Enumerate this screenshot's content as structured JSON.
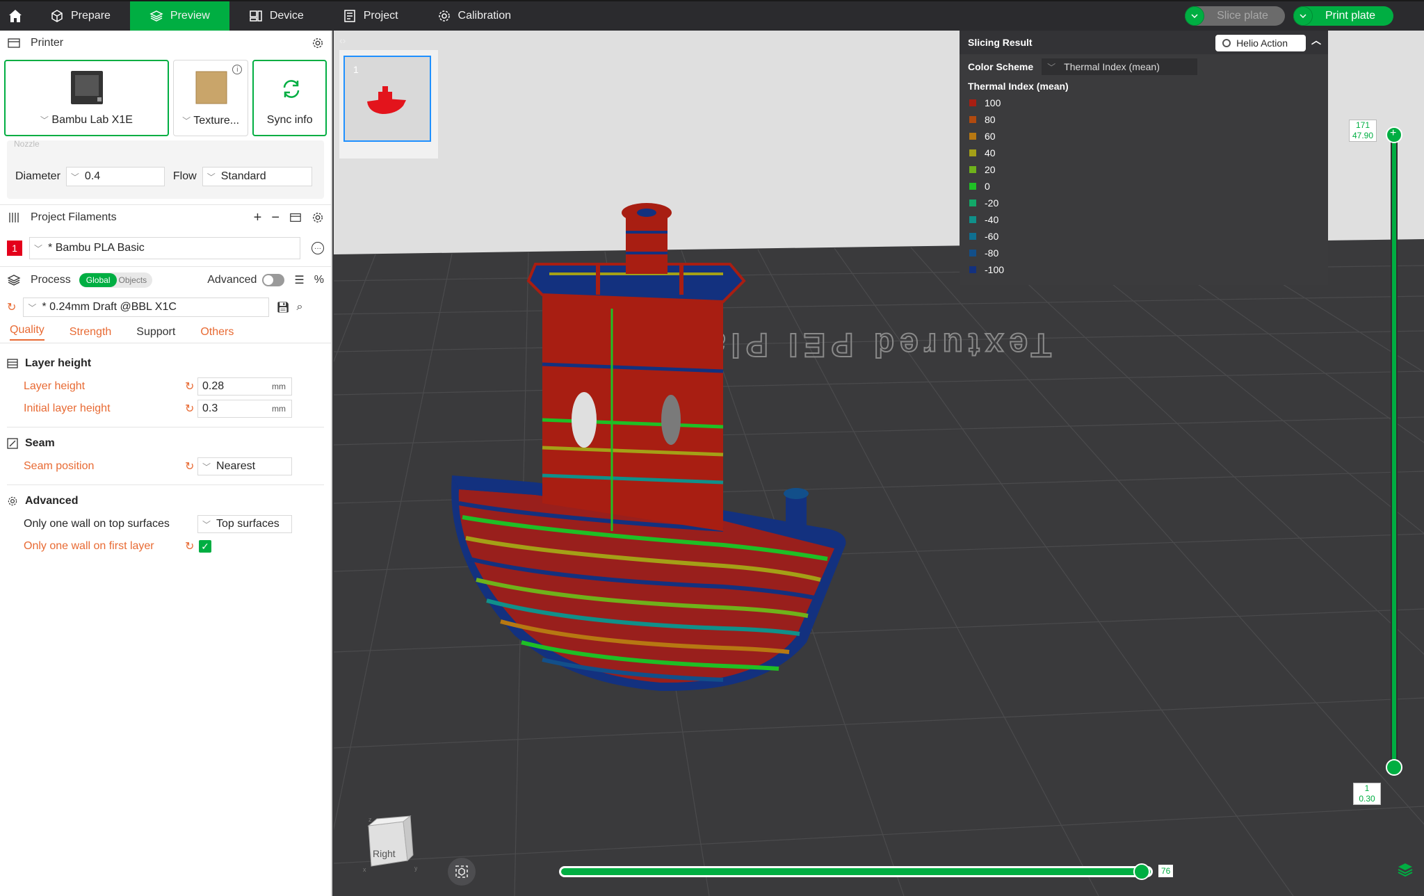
{
  "topbar": {
    "tabs": [
      {
        "label": "Prepare",
        "active": false
      },
      {
        "label": "Preview",
        "active": true
      },
      {
        "label": "Device",
        "active": false
      },
      {
        "label": "Project",
        "active": false
      },
      {
        "label": "Calibration",
        "active": false
      }
    ],
    "slice_label": "Slice plate",
    "print_label": "Print plate"
  },
  "printer": {
    "title": "Printer",
    "model": "Bambu Lab X1E",
    "plate": "Texture...",
    "sync": "Sync info",
    "nozzle_label": "Nozzle",
    "diameter_label": "Diameter",
    "diameter_value": "0.4",
    "flow_label": "Flow",
    "flow_value": "Standard"
  },
  "filaments": {
    "title": "Project Filaments",
    "items": [
      {
        "num": "1",
        "name": "* Bambu PLA Basic",
        "color": "#e4001b"
      }
    ]
  },
  "process": {
    "title": "Process",
    "global": "Global",
    "objects": "Objects",
    "advanced": "Advanced",
    "preset": "* 0.24mm Draft @BBL X1C",
    "tabs": [
      "Quality",
      "Strength",
      "Support",
      "Others"
    ],
    "groups": {
      "layer_height": {
        "title": "Layer height",
        "layer_height_label": "Layer height",
        "layer_height_value": "0.28",
        "initial_label": "Initial layer height",
        "initial_value": "0.3",
        "unit": "mm"
      },
      "seam": {
        "title": "Seam",
        "position_label": "Seam position",
        "position_value": "Nearest"
      },
      "advanced": {
        "title": "Advanced",
        "one_wall_top_label": "Only one wall on top surfaces",
        "one_wall_top_value": "Top surfaces",
        "one_wall_first_label": "Only one wall on first layer",
        "one_wall_first_checked": true
      }
    }
  },
  "viewport": {
    "plate_number": "1",
    "bed_text": "Textured PEI Plate",
    "cube_label": "Right",
    "layer_top": "171",
    "layer_top_height": "47.90",
    "layer_bottom": "1",
    "layer_bottom_height": "0.30",
    "move_value": "76",
    "move_progress": 1.0
  },
  "slicing_result": {
    "title": "Slicing Result",
    "helio": "Helio Action",
    "scheme_label": "Color Scheme",
    "scheme_value": "Thermal Index (mean)",
    "legend_title": "Thermal Index (mean)",
    "legend": [
      {
        "label": "100",
        "color": "#a81e12"
      },
      {
        "label": "80",
        "color": "#b14a0f"
      },
      {
        "label": "60",
        "color": "#b77812"
      },
      {
        "label": "40",
        "color": "#a4a017"
      },
      {
        "label": "20",
        "color": "#6fb21b"
      },
      {
        "label": "0",
        "color": "#1fbf25"
      },
      {
        "label": "-20",
        "color": "#12a868"
      },
      {
        "label": "-40",
        "color": "#10908a"
      },
      {
        "label": "-60",
        "color": "#0f6f90"
      },
      {
        "label": "-80",
        "color": "#124f8a"
      },
      {
        "label": "-100",
        "color": "#13317f"
      }
    ]
  },
  "colors": {
    "accent": "#00ae42",
    "modified": "#e86a33"
  }
}
